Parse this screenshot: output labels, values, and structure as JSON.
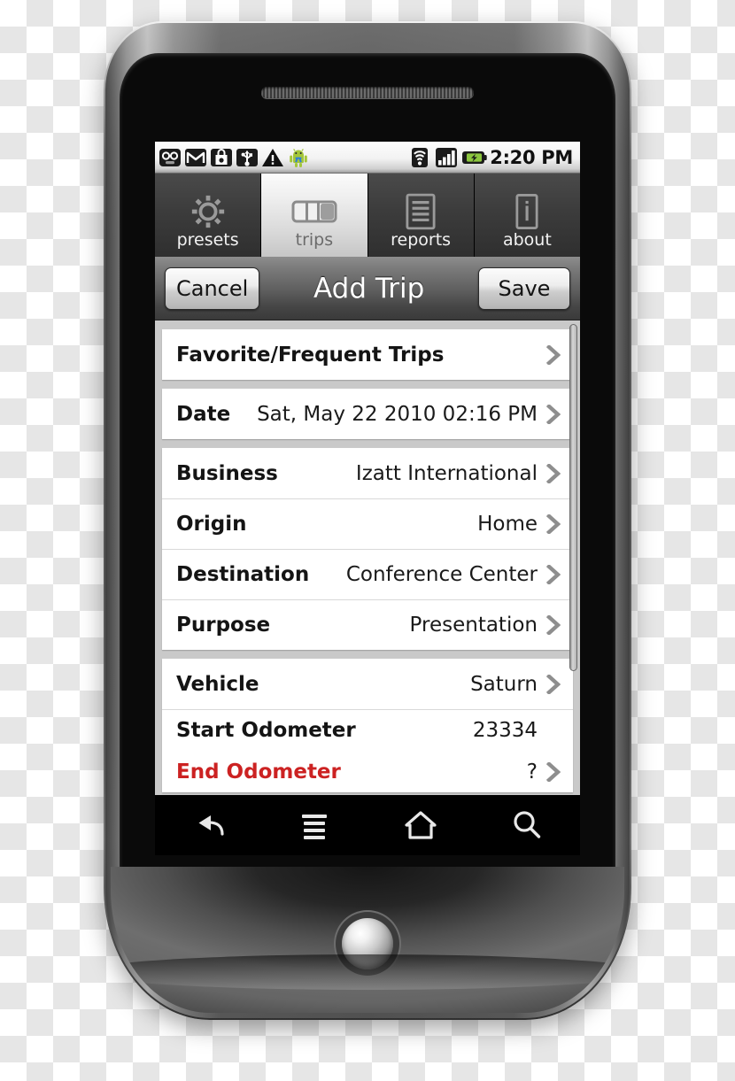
{
  "statusbar": {
    "icons_left": [
      "voicemail-icon",
      "gmail-icon",
      "market-bag-icon",
      "usb-icon",
      "warning-icon",
      "android-robot-icon"
    ],
    "icons_right": [
      "wifi-icon",
      "signal-bars-icon",
      "battery-charging-icon"
    ],
    "time": "2:20 PM"
  },
  "tabs": [
    {
      "label": "presets",
      "icon": "gear-icon",
      "active": false
    },
    {
      "label": "trips",
      "icon": "trips-icon",
      "active": true
    },
    {
      "label": "reports",
      "icon": "document-lines-icon",
      "active": false
    },
    {
      "label": "about",
      "icon": "info-icon",
      "active": false
    }
  ],
  "titlebar": {
    "cancel_label": "Cancel",
    "title": "Add Trip",
    "save_label": "Save"
  },
  "groups": [
    {
      "rows": [
        {
          "label": "Favorite/Frequent Trips",
          "value": "",
          "chevron": true,
          "alert": false
        }
      ]
    },
    {
      "rows": [
        {
          "label": "Date",
          "value": "Sat, May 22 2010 02:16 PM",
          "chevron": true,
          "alert": false
        }
      ]
    },
    {
      "rows": [
        {
          "label": "Business",
          "value": "Izatt International",
          "chevron": true,
          "alert": false
        },
        {
          "label": "Origin",
          "value": "Home",
          "chevron": true,
          "alert": false
        },
        {
          "label": "Destination",
          "value": "Conference Center",
          "chevron": true,
          "alert": false
        },
        {
          "label": "Purpose",
          "value": "Presentation",
          "chevron": true,
          "alert": false
        }
      ]
    },
    {
      "rows": [
        {
          "label": "Vehicle",
          "value": "Saturn",
          "chevron": true,
          "alert": false
        },
        {
          "label": "Start Odometer",
          "value": "23334",
          "chevron": false,
          "alert": false
        },
        {
          "label": "End Odometer",
          "value": "?",
          "chevron": true,
          "alert": true
        }
      ]
    }
  ],
  "softkeys": [
    {
      "name": "back-icon"
    },
    {
      "name": "menu-icon"
    },
    {
      "name": "home-icon"
    },
    {
      "name": "search-icon"
    }
  ],
  "colors": {
    "alert_text": "#cc2222",
    "list_background": "#c9c9c9",
    "row_background": "#ffffff",
    "active_tab_text": "#6b6b6b",
    "battery_green": "#8cc63f"
  }
}
